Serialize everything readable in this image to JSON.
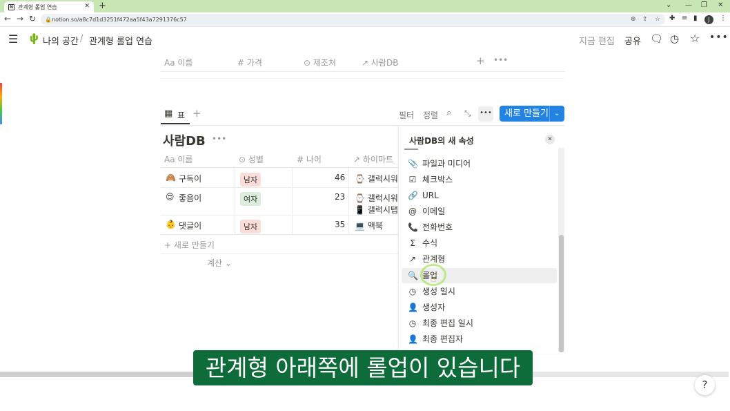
{
  "browser": {
    "tab_title": "관계형 롤업 연습",
    "tab_favicon": "N",
    "url": "notion.so/a8c7d1d3251f472aa5f43a7291376c57",
    "profile_initial": "J"
  },
  "topbar": {
    "workspace": "나의 공간",
    "separator": "/",
    "page_title": "관계형 롤업 연습",
    "edited_label": "지금 편집",
    "share_label": "공유"
  },
  "upper_table": {
    "columns": [
      {
        "icon": "Aa",
        "label": "이름"
      },
      {
        "icon": "#",
        "label": "가격"
      },
      {
        "icon": "⊙",
        "label": "제조처"
      },
      {
        "icon": "↗",
        "label": "사람DB"
      }
    ]
  },
  "view": {
    "tab_label": "표",
    "filter_label": "필터",
    "sort_label": "정렬",
    "new_label": "새로 만들기"
  },
  "db": {
    "title": "사람DB",
    "columns": [
      {
        "icon": "Aa",
        "label": "이름"
      },
      {
        "icon": "⊙",
        "label": "성별"
      },
      {
        "icon": "#",
        "label": "나이"
      },
      {
        "icon": "↗",
        "label": "하이마트"
      }
    ],
    "rows": [
      {
        "emoji": "🙈",
        "name": "구독이",
        "gender": "남자",
        "age": "46",
        "relations": [
          "⌚ 갤럭시워"
        ]
      },
      {
        "emoji": "😍",
        "name": "좋음이",
        "gender": "여자",
        "age": "23",
        "relations": [
          "⌚ 갤럭시워",
          "📱 갤럭시탭"
        ]
      },
      {
        "emoji": "👶",
        "name": "댓글이",
        "gender": "남자",
        "age": "35",
        "relations": [
          "💻 맥북"
        ]
      }
    ],
    "add_row_label": "+ 새로 만들기",
    "calc_label": "계산"
  },
  "panel": {
    "title": "사람DB의 새 속성",
    "items": [
      {
        "icon": "📎",
        "label": "파일과 미디어"
      },
      {
        "icon": "☑",
        "label": "체크박스"
      },
      {
        "icon": "🔗",
        "label": "URL"
      },
      {
        "icon": "@",
        "label": "이메일"
      },
      {
        "icon": "📞",
        "label": "전화번호"
      },
      {
        "icon": "Σ",
        "label": "수식"
      },
      {
        "icon": "↗",
        "label": "관계형"
      },
      {
        "icon": "🔍",
        "label": "롤업"
      },
      {
        "icon": "◷",
        "label": "생성 일시"
      },
      {
        "icon": "👤",
        "label": "생성자"
      },
      {
        "icon": "◷",
        "label": "최종 편집 일시"
      },
      {
        "icon": "👤",
        "label": "최종 편집자"
      }
    ],
    "highlighted_index": 7
  },
  "subtitle": "관계형 아래쪽에 롤업이 있습니다",
  "help_label": "?"
}
